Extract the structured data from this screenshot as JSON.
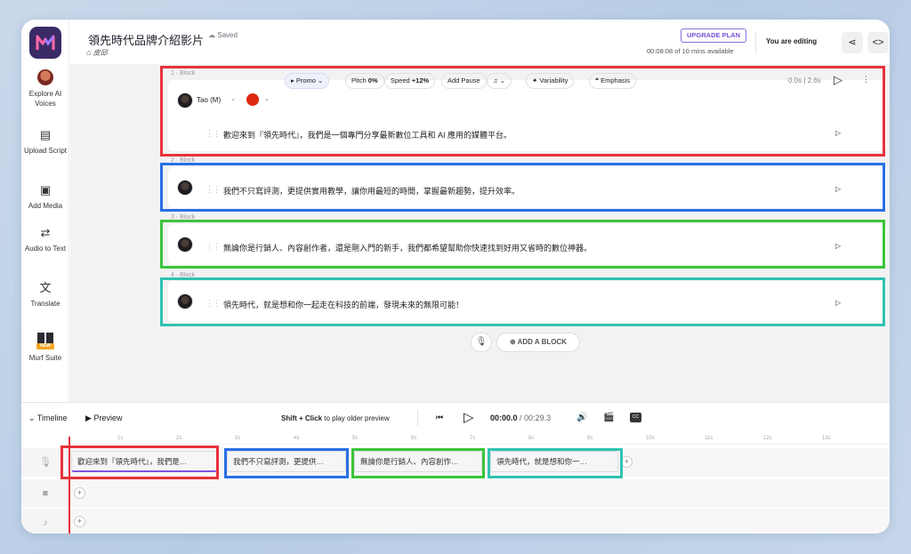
{
  "header": {
    "title": "領先時代品牌介紹影片",
    "saved": "Saved",
    "breadcrumb": "皮邱",
    "upgrade": "UPGRADE PLAN",
    "mins": "00:08:08 of 10 mins available",
    "editing": "You are editing"
  },
  "sidebar": {
    "items": [
      {
        "label": "Explore AI Voices"
      },
      {
        "label": "Upload Script"
      },
      {
        "label": "Add Media"
      },
      {
        "label": "Audio to Text"
      },
      {
        "label": "Translate"
      },
      {
        "label": "Murf Suite",
        "badge": "NEW"
      }
    ]
  },
  "blocks": [
    {
      "label": "1 · Block",
      "text": "歡迎來到『領先時代』，我們是一個專門分享最新數位工具和 AI 應用的媒體平台。",
      "color": "#e8323c"
    },
    {
      "label": "2 · Block",
      "text": "我們不只寫評測，更提供實用教學，讓你用最短的時間，掌握最新趨勢，提升效率。",
      "color": "#2a6fe6"
    },
    {
      "label": "3 · Block",
      "text": "無論你是行銷人、內容創作者，還是剛入門的新手，我們都希望幫助你快速找到好用又省時的數位神器。",
      "color": "#3cc43c"
    },
    {
      "label": "4 · Block",
      "text": "領先時代，就是想和你一起走在科技的前端，發現未來的無限可能！",
      "color": "#30c2b0"
    }
  ],
  "toolbar": {
    "voice": "Tao (M)",
    "style": "Promo",
    "pitch": "Pitch",
    "pitch_val": "0%",
    "speed": "Speed",
    "speed_val": "+12%",
    "add_pause": "Add Pause",
    "variability": "Variability",
    "emphasis": "Emphasis",
    "timing": "0.0s | 2.6s"
  },
  "add_block": "ADD A BLOCK",
  "timeline": {
    "label": "Timeline",
    "preview": "Preview",
    "hint_bold": "Shift + Click",
    "hint": " to play older preview",
    "time_cur": "00:00.0",
    "time_total": "/ 00:29.3",
    "ticks": [
      "1s",
      "2s",
      "3s",
      "4s",
      "5s",
      "6s",
      "7s",
      "8s",
      "9s",
      "10s",
      "11s",
      "12s",
      "13s"
    ],
    "clips": [
      "歡迎來到『領先時代』，我們是…",
      "我們不只寫評測，更提供…",
      "無論你是行銷人、內容創作…",
      "領先時代，就是想和你一…"
    ]
  }
}
